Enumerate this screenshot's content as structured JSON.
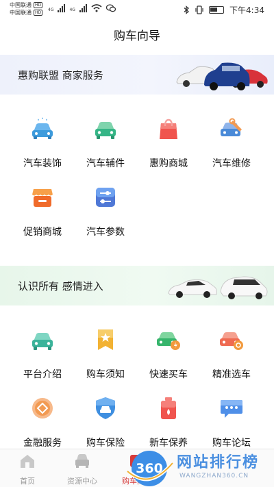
{
  "status_bar": {
    "carrier1": "中国联通",
    "carrier2": "中国联通",
    "hd": "HD",
    "net": "4G",
    "time": "下午4:34"
  },
  "page_title": "购车向导",
  "banner1": {
    "text": "惠购联盟 商家服务"
  },
  "section1": {
    "items": [
      {
        "label": "汽车装饰",
        "icon": "car-wash-icon",
        "color": "#3d9bdc"
      },
      {
        "label": "汽车辅件",
        "icon": "car-icon",
        "color": "#35b586"
      },
      {
        "label": "惠购商城",
        "icon": "shopping-bag-icon",
        "color": "#f0544e"
      },
      {
        "label": "汽车维修",
        "icon": "car-repair-icon",
        "color": "#4a8ad8"
      },
      {
        "label": "促销商城",
        "icon": "promo-store-icon",
        "color": "#f06b2b"
      },
      {
        "label": "汽车参数",
        "icon": "sliders-icon",
        "color": "#4f78d6"
      }
    ]
  },
  "banner2": {
    "text": "认识所有 感情进入"
  },
  "section2": {
    "items": [
      {
        "label": "平台介绍",
        "icon": "car-icon",
        "color": "#3ab39a"
      },
      {
        "label": "购车须知",
        "icon": "star-badge-icon",
        "color": "#f2b233"
      },
      {
        "label": "快速买车",
        "icon": "fast-car-icon",
        "color": "#36b56c"
      },
      {
        "label": "精准选车",
        "icon": "car-select-icon",
        "color": "#ef6b52"
      },
      {
        "label": "金融服务",
        "icon": "coin-icon",
        "color": "#f29a52"
      },
      {
        "label": "购车保险",
        "icon": "shield-icon",
        "color": "#3f8fe0"
      },
      {
        "label": "新车保养",
        "icon": "oil-can-icon",
        "color": "#f0544e"
      },
      {
        "label": "购车论坛",
        "icon": "chat-icon",
        "color": "#4f8fe8"
      }
    ]
  },
  "bottom_nav": {
    "items": [
      {
        "label": "首页",
        "icon": "home-icon"
      },
      {
        "label": "资源中心",
        "icon": "car-front-icon"
      },
      {
        "label": "购车向导",
        "icon": "guide-icon"
      }
    ]
  },
  "watermark": {
    "text": "网站排行榜",
    "sub": "WANGZHAN360.CN",
    "badge": "360"
  }
}
